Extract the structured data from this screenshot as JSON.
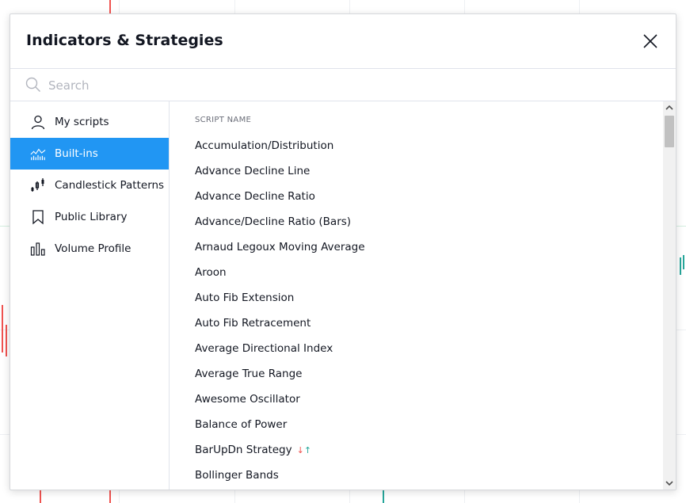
{
  "dialog": {
    "title": "Indicators & Strategies"
  },
  "search": {
    "placeholder": "Search",
    "value": ""
  },
  "sidebar": {
    "items": [
      {
        "label": "My scripts",
        "icon": "user-icon",
        "active": false
      },
      {
        "label": "Built-ins",
        "icon": "chart-bars-icon",
        "active": true
      },
      {
        "label": "Candlestick Patterns",
        "icon": "candlestick-icon",
        "active": false
      },
      {
        "label": "Public Library",
        "icon": "bookmark-icon",
        "active": false
      },
      {
        "label": "Volume Profile",
        "icon": "volume-profile-icon",
        "active": false
      }
    ]
  },
  "main": {
    "column_header": "SCRIPT NAME",
    "scripts": [
      "Accumulation/Distribution",
      "Advance Decline Line",
      "Advance Decline Ratio",
      "Advance/Decline Ratio (Bars)",
      "Arnaud Legoux Moving Average",
      "Aroon",
      "Auto Fib Extension",
      "Auto Fib Retracement",
      "Average Directional Index",
      "Average True Range",
      "Awesome Oscillator",
      "Balance of Power",
      "BarUpDn Strategy",
      "Bollinger Bands"
    ],
    "strategy_badge": {
      "down": "↓",
      "up": "↑"
    }
  },
  "colors": {
    "accent": "#2196f3",
    "text": "#131722",
    "muted": "#6a6d78",
    "strategy_up": "#26a69a",
    "strategy_down": "#ef5350"
  }
}
